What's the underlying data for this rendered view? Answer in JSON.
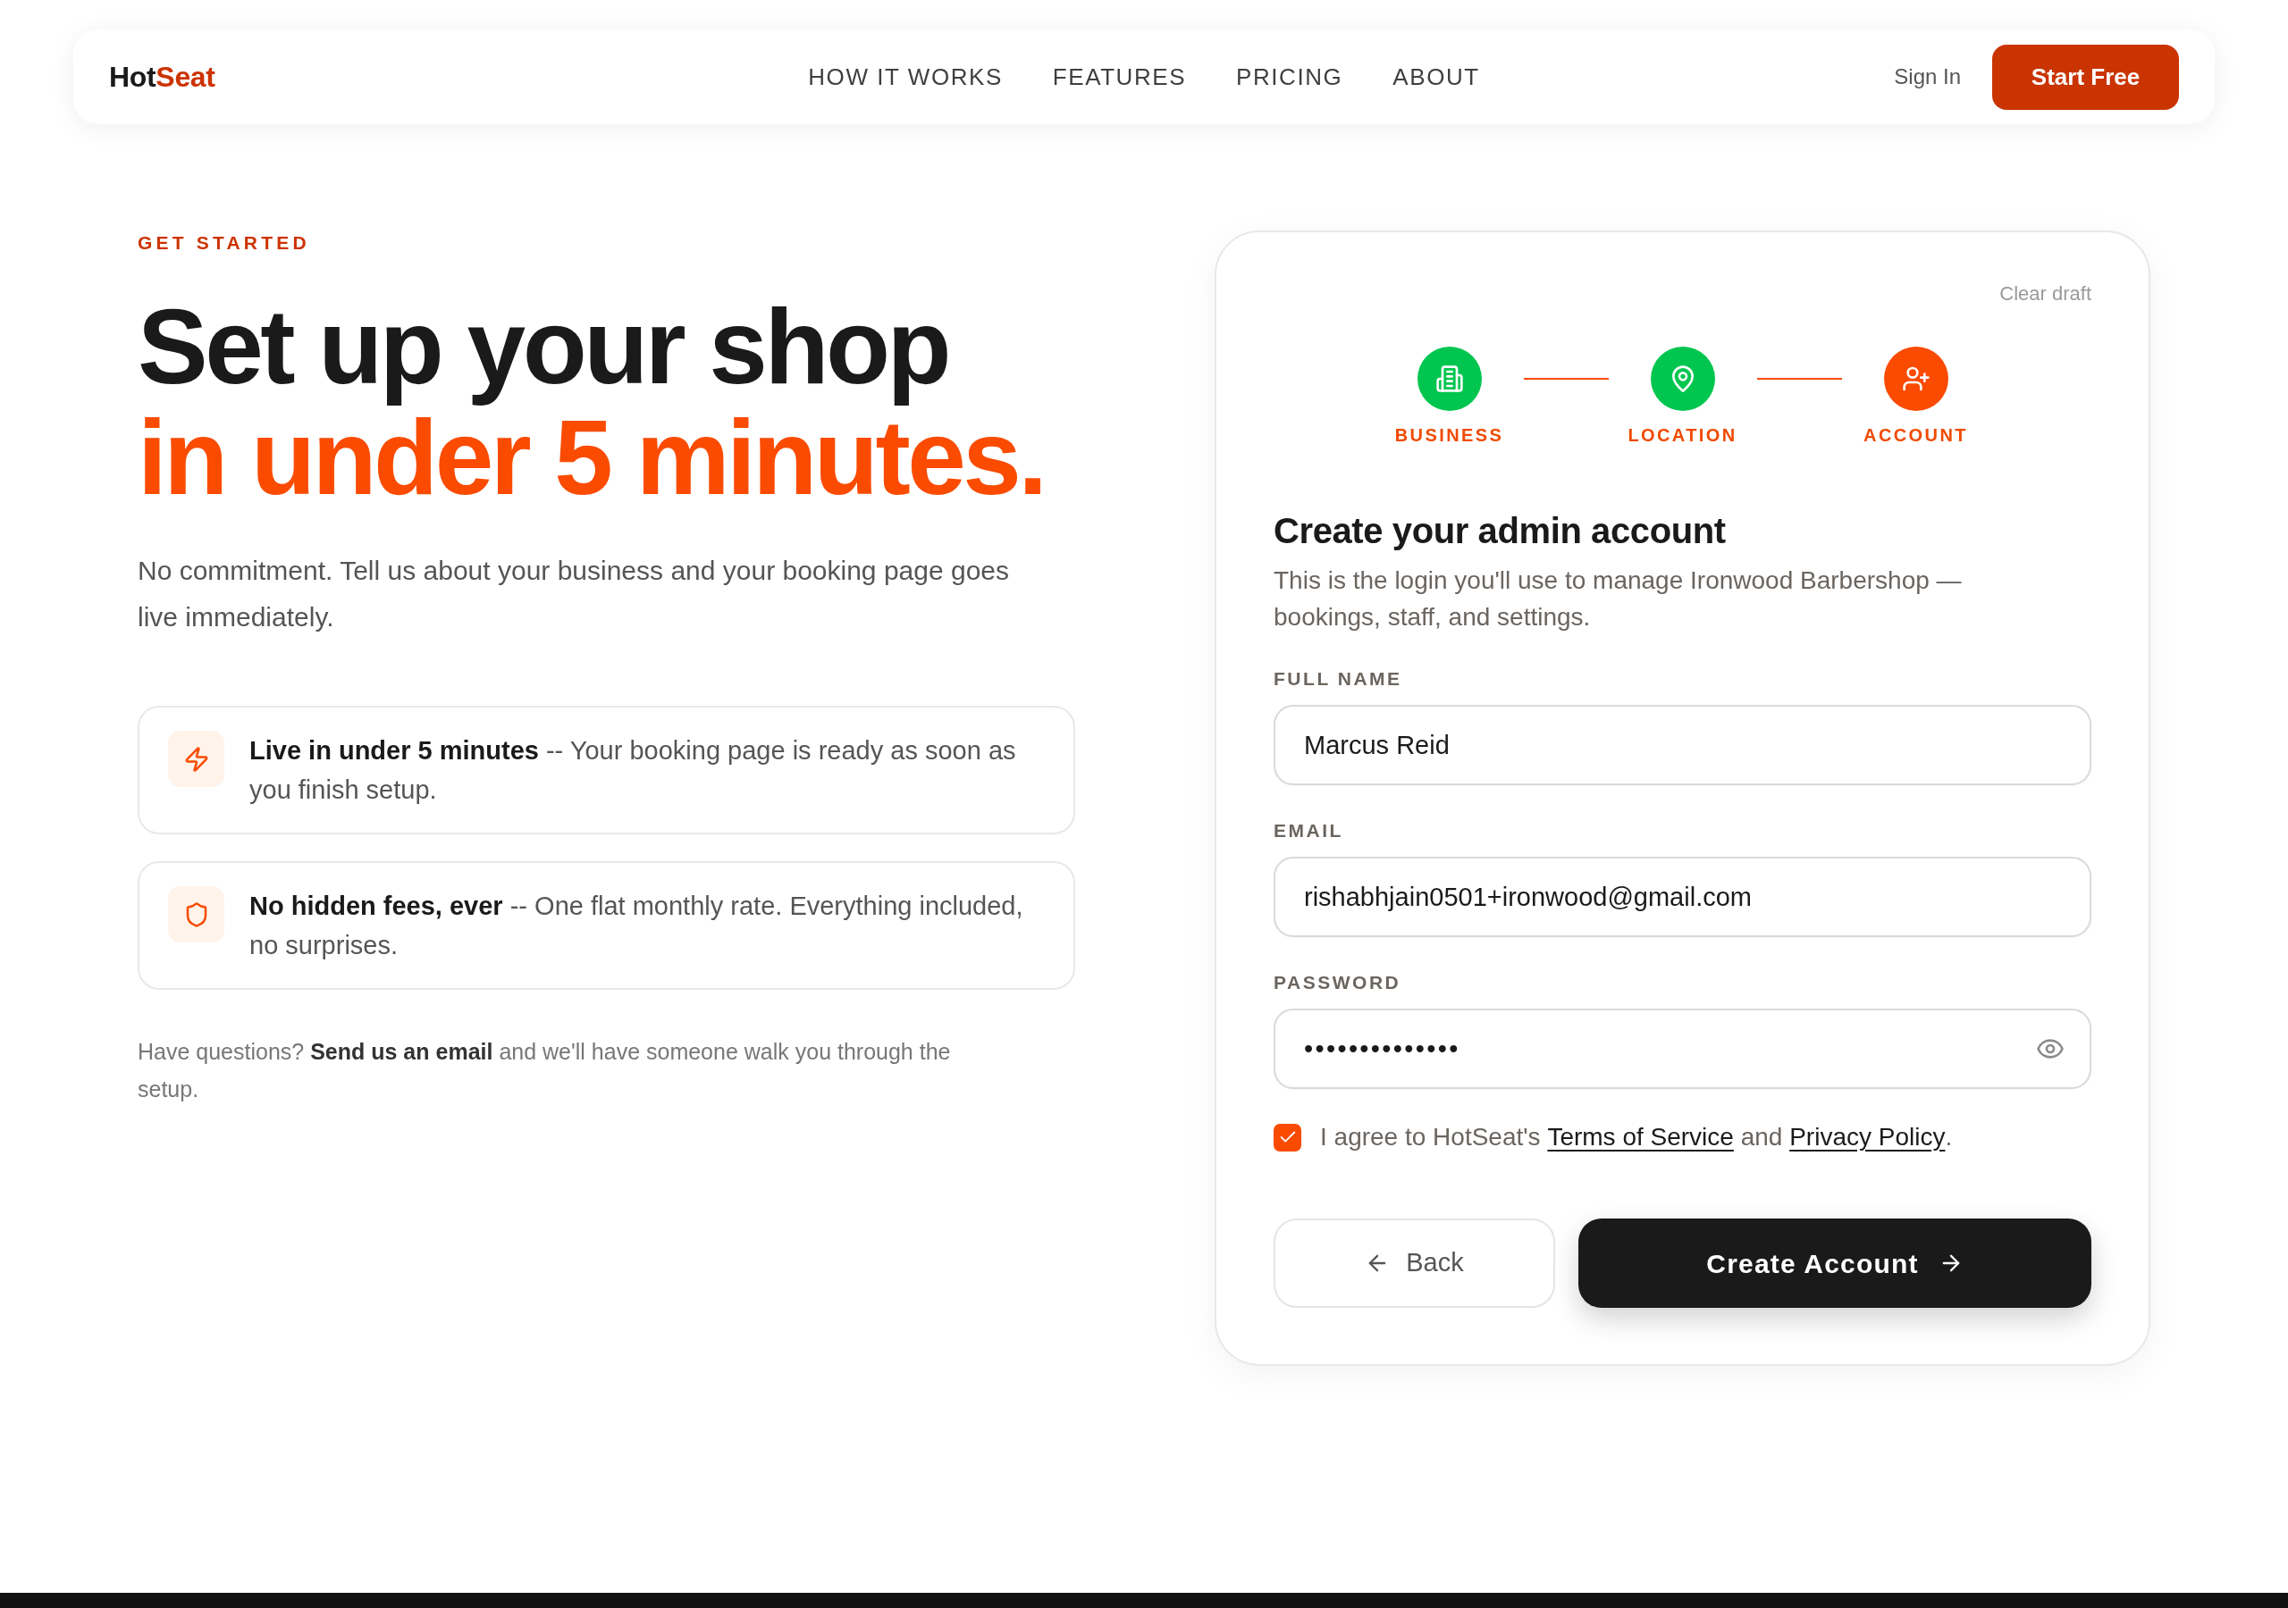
{
  "nav": {
    "logo": [
      {
        "text": "Hot",
        "accent": false
      },
      {
        "text": "Seat",
        "accent": true
      }
    ],
    "links": [
      "HOW IT WORKS",
      "FEATURES",
      "PRICING",
      "ABOUT"
    ],
    "sign_in": "Sign In",
    "cta": "Start Free"
  },
  "hero": {
    "eyebrow": "GET STARTED",
    "headline": [
      {
        "text": "Set up your shop",
        "accent": false
      },
      {
        "text": "in under 5 minutes.",
        "accent": true
      }
    ],
    "intro": "No commitment. Tell us about your business and your booking page goes live immediately.",
    "features": [
      "**Live in under 5 minutes** -- Your booking page is ready as soon as you finish setup.",
      "**No hidden fees, ever** -- One flat monthly rate. Everything included, no surprises."
    ],
    "help": [
      {
        "kind": "text",
        "text": "Have questions? "
      },
      {
        "kind": "link",
        "text": "Send us an email"
      },
      {
        "kind": "text",
        "text": " and we'll have someone walk you through the setup."
      }
    ]
  },
  "signup": {
    "clear_draft": "Clear draft",
    "steps": [
      {
        "label": "BUSINESS",
        "completed": true
      },
      {
        "label": "LOCATION",
        "completed": true
      },
      {
        "label": "ACCOUNT",
        "completed": false
      }
    ],
    "title": "Create your admin account",
    "subtitle": "This is the login you'll use to manage Ironwood Barbershop — bookings, staff, and settings.",
    "fields": [
      {
        "kind": "text",
        "label": "FULL NAME",
        "value": "Marcus Reid"
      },
      {
        "kind": "email",
        "label": "EMAIL",
        "value": "rishabhjain0501+ironwood@gmail.com"
      },
      {
        "kind": "password",
        "label": "PASSWORD",
        "value": "••••••••••••••"
      }
    ],
    "agreement": {
      "checked": true,
      "segments": [
        {
          "kind": "text",
          "text": "I agree to HotSeat's "
        },
        {
          "kind": "link",
          "text": "Terms of Service"
        },
        {
          "kind": "text",
          "text": " and "
        },
        {
          "kind": "link",
          "text": "Privacy Policy"
        },
        {
          "kind": "text",
          "text": "."
        }
      ]
    },
    "back": "Back",
    "submit": "Create Account"
  }
}
